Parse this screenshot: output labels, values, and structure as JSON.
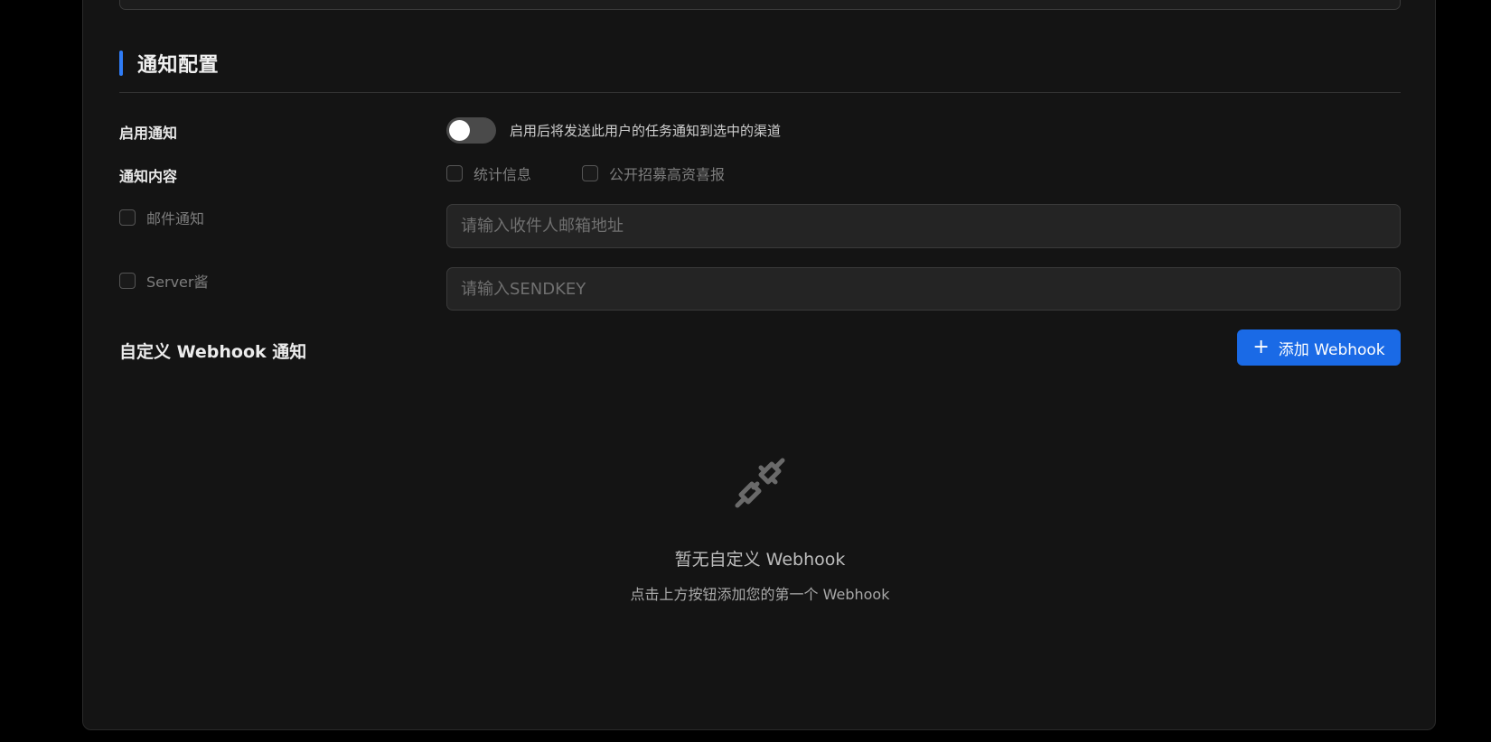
{
  "section": {
    "title": "通知配置",
    "accent_color": "#2f7cf6"
  },
  "enable_notify": {
    "label": "启用通知",
    "toggle_on": false,
    "help": "启用后将发送此用户的任务通知到选中的渠道"
  },
  "content": {
    "label": "通知内容",
    "options": [
      {
        "label": "统计信息",
        "checked": false
      },
      {
        "label": "公开招募高资喜报",
        "checked": false
      }
    ]
  },
  "email": {
    "label": "邮件通知",
    "checked": false,
    "placeholder": "请输入收件人邮箱地址"
  },
  "serverchan": {
    "label": "Server酱",
    "checked": false,
    "placeholder": "请输入SENDKEY"
  },
  "webhook": {
    "title": "自定义 Webhook 通知",
    "add_button": "添加 Webhook",
    "add_icon": "plus-icon",
    "empty_icon": "plug-disconnected-icon",
    "empty_title": "暂无自定义 Webhook",
    "empty_hint": "点击上方按钮添加您的第一个 Webhook",
    "button_color": "#1a6ae6"
  }
}
